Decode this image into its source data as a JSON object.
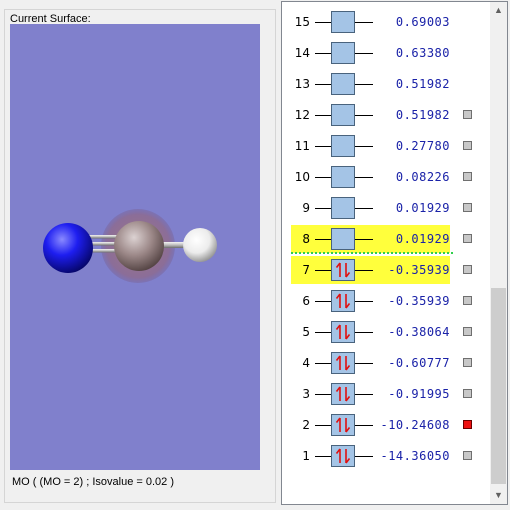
{
  "surface": {
    "group_title": "Current Surface:",
    "caption": "MO ( (MO = 2) ; Isovalue = 0.02 )"
  },
  "colors": {
    "viewport_bg": "#8080cc",
    "nitrogen": "#1010e0",
    "carbon": "#9a8a8a",
    "hydrogen": "#f2f2f2",
    "highlight": "#ffff3c",
    "energy_text": "#1a22a8",
    "electron_arrow": "#e01010",
    "checkbox_selected": "#ee1111"
  },
  "molecule": {
    "atoms": [
      "N",
      "C",
      "H"
    ]
  },
  "orbitals": [
    {
      "num": "15",
      "energy": "0.69003",
      "occupied": false,
      "highlighted": false,
      "surface": false,
      "has_checkbox": false
    },
    {
      "num": "14",
      "energy": "0.63380",
      "occupied": false,
      "highlighted": false,
      "surface": false,
      "has_checkbox": false
    },
    {
      "num": "13",
      "energy": "0.51982",
      "occupied": false,
      "highlighted": false,
      "surface": false,
      "has_checkbox": false
    },
    {
      "num": "12",
      "energy": "0.51982",
      "occupied": false,
      "highlighted": false,
      "surface": false,
      "has_checkbox": true
    },
    {
      "num": "11",
      "energy": "0.27780",
      "occupied": false,
      "highlighted": false,
      "surface": false,
      "has_checkbox": true
    },
    {
      "num": "10",
      "energy": "0.08226",
      "occupied": false,
      "highlighted": false,
      "surface": false,
      "has_checkbox": true
    },
    {
      "num": "9",
      "energy": "0.01929",
      "occupied": false,
      "highlighted": false,
      "surface": false,
      "has_checkbox": true
    },
    {
      "num": "8",
      "energy": "0.01929",
      "occupied": false,
      "highlighted": true,
      "surface": false,
      "has_checkbox": true
    },
    {
      "num": "7",
      "energy": "-0.35939",
      "occupied": true,
      "highlighted": true,
      "surface": false,
      "has_checkbox": true
    },
    {
      "num": "6",
      "energy": "-0.35939",
      "occupied": true,
      "highlighted": false,
      "surface": false,
      "has_checkbox": true
    },
    {
      "num": "5",
      "energy": "-0.38064",
      "occupied": true,
      "highlighted": false,
      "surface": false,
      "has_checkbox": true
    },
    {
      "num": "4",
      "energy": "-0.60777",
      "occupied": true,
      "highlighted": false,
      "surface": false,
      "has_checkbox": true
    },
    {
      "num": "3",
      "energy": "-0.91995",
      "occupied": true,
      "highlighted": false,
      "surface": false,
      "has_checkbox": true
    },
    {
      "num": "2",
      "energy": "-10.24608",
      "occupied": true,
      "highlighted": false,
      "surface": true,
      "has_checkbox": true
    },
    {
      "num": "1",
      "energy": "-14.36050",
      "occupied": true,
      "highlighted": false,
      "surface": false,
      "has_checkbox": true
    }
  ],
  "scrollbar": {
    "up_icon": "scroll-up-arrow",
    "down_icon": "scroll-down-arrow"
  }
}
